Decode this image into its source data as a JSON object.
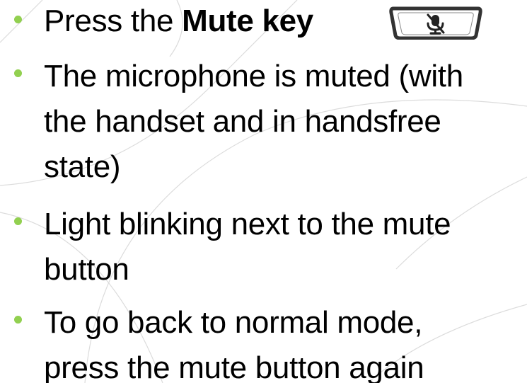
{
  "bullets": [
    {
      "pre": "Press the ",
      "bold": "Mute key",
      "post": ""
    },
    {
      "line1": "The microphone is muted (with",
      "line2": "the handset and in handsfree",
      "line3": "state)"
    },
    {
      "line1": "Light blinking next to the mute",
      "line2": "button"
    },
    {
      "line1": "To go back to normal mode,",
      "line2": "press the mute button again"
    }
  ],
  "icons": {
    "mute_key": "muted-microphone-key-icon"
  },
  "colors": {
    "bullet": "#92d050",
    "text": "#000000",
    "background": "#ffffff",
    "decor": "#d9d9d9"
  }
}
